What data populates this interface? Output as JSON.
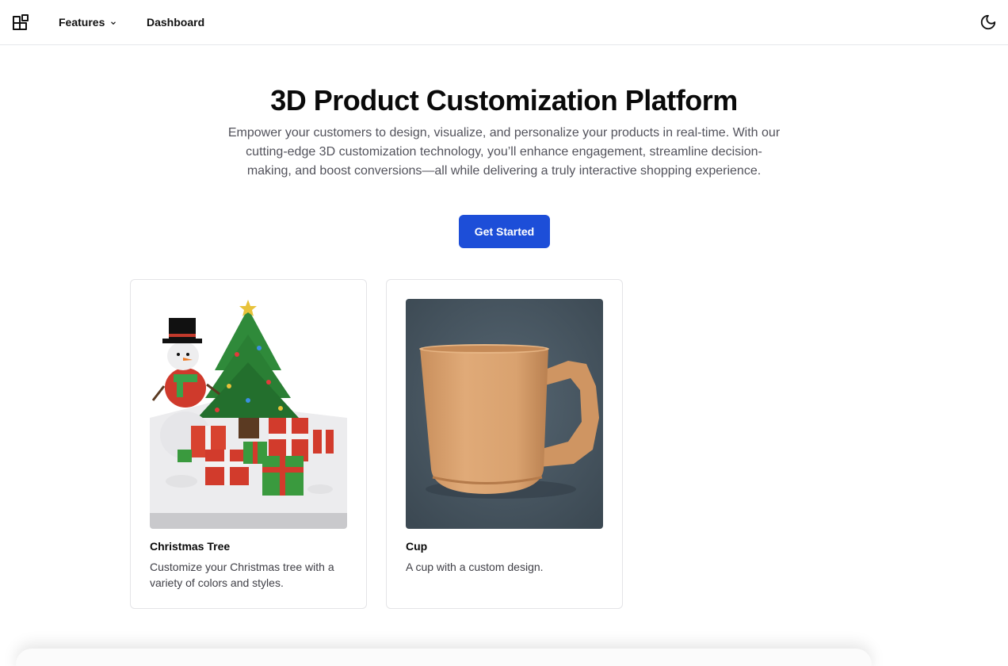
{
  "nav": {
    "features_label": "Features",
    "dashboard_label": "Dashboard"
  },
  "hero": {
    "title": "3D Product Customization Platform",
    "subtitle": "Empower your customers to design, visualize, and personalize your products in real-time. With our cutting-edge 3D customization technology, you’ll enhance engagement, streamline decision-making, and boost conversions—all while delivering a truly interactive shopping experience.",
    "cta_label": "Get Started"
  },
  "products": [
    {
      "title": "Christmas Tree",
      "description": "Customize your Christmas tree with a variety of colors and styles."
    },
    {
      "title": "Cup",
      "description": "A cup with a custom design."
    }
  ],
  "colors": {
    "primary": "#1d4ed8",
    "border": "#e4e4e7",
    "muted_text": "#52525b",
    "cup_background": "#4a5a66",
    "cup_color": "#d9a26f"
  }
}
